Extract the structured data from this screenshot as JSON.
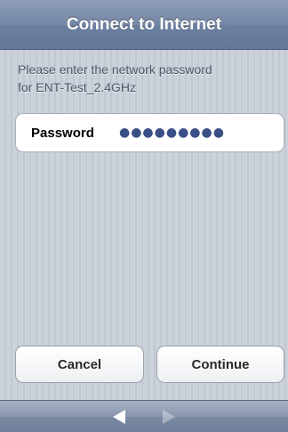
{
  "title_bar": {
    "title": "Connect to Internet"
  },
  "prompt": {
    "line1": "Please enter the network password",
    "line2": "for ENT-Test_2.4GHz"
  },
  "password_field": {
    "label": "Password",
    "masked_value": "●●●●●●●●●"
  },
  "buttons": {
    "cancel_label": "Cancel",
    "continue_label": "Continue"
  },
  "toolbar": {
    "back_icon": "left-arrow-icon",
    "forward_icon": "right-arrow-icon"
  },
  "colors": {
    "title_bar": "#7487a6",
    "background": "#c5ccd4",
    "password_dots": "#3a4f86"
  }
}
